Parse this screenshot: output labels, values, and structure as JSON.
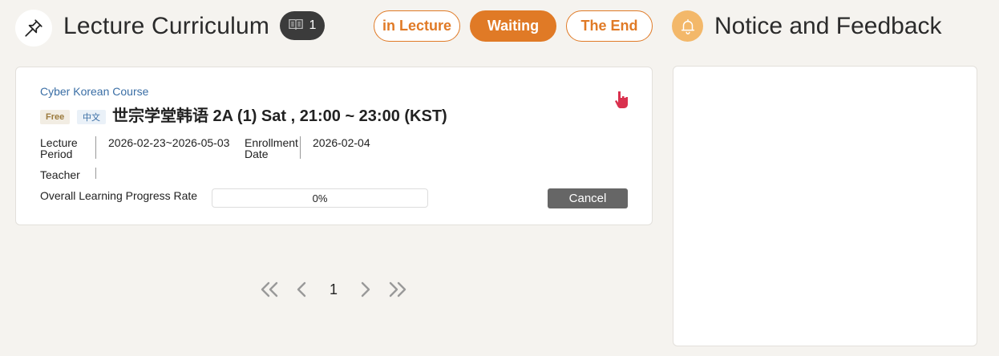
{
  "header": {
    "title": "Lecture Curriculum",
    "count": "1",
    "notice_title": "Notice and Feedback"
  },
  "tabs": [
    {
      "label": "in Lecture",
      "active": false
    },
    {
      "label": "Waiting",
      "active": true
    },
    {
      "label": "The End",
      "active": false
    }
  ],
  "course": {
    "category": "Cyber Korean Course",
    "tag_free": "Free",
    "tag_lang": "中文",
    "name": "世宗学堂韩语 2A (1) Sat , 21:00 ~ 23:00 (KST)",
    "period_label_1": "Lecture",
    "period_label_2": "Period",
    "period_value": "2026-02-23~2026-05-03",
    "enroll_label_1": "Enrollment",
    "enroll_label_2": "Date",
    "enroll_value": "2026-02-04",
    "teacher_label": "Teacher",
    "teacher_value": "",
    "progress_label": "Overall Learning Progress Rate",
    "progress_value": 0,
    "progress_text": "0%",
    "cancel_label": "Cancel"
  },
  "pagination": {
    "current": "1"
  },
  "colors": {
    "accent": "#e07a26",
    "link": "#3a6ea5",
    "bell": "#f3b86a",
    "hand": "#d9314e"
  },
  "icons": {
    "header": "pushpin-icon",
    "badge": "book-icon",
    "notice": "bell-icon",
    "card": "pointing-hand-icon"
  }
}
